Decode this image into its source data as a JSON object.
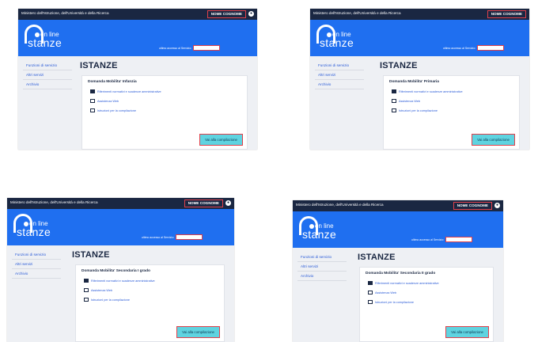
{
  "header": {
    "ministry": "Ministero dell'Istruzione, dell'Università e della Ricerca",
    "user_name": "NOME COGNOME",
    "user_icon": "user-icon",
    "logo_online": "on line",
    "logo_istanze": "stanze",
    "last_access_label": "ultimo accesso al Servizio:",
    "last_access_value": ""
  },
  "sidebar": {
    "items": [
      "Funzioni di servizio",
      "Altri servizi",
      "Archivio"
    ]
  },
  "main": {
    "title": "ISTANZE",
    "links": [
      {
        "icon": "document-pages-icon",
        "label": "Riferimenti normativi e scadenze amministrative"
      },
      {
        "icon": "web-assistance-icon",
        "label": "Assistenza Web"
      },
      {
        "icon": "instructions-icon",
        "label": "Istruzioni per la compilazione"
      }
    ],
    "button_label": "Vai alla compilazione"
  },
  "screenshots": [
    {
      "domanda": "Domanda Mobilita' Infanzia"
    },
    {
      "domanda": "Domanda Mobilita' Primaria"
    },
    {
      "domanda": "Domanda Mobilita' Secondaria I grado"
    },
    {
      "domanda": "Domanda Mobilita' Secondaria II grado"
    }
  ],
  "colors": {
    "topbar": "#1a2742",
    "header_blue": "#1f6ff0",
    "button": "#5fd3e0",
    "highlight_red": "#e0404a"
  }
}
